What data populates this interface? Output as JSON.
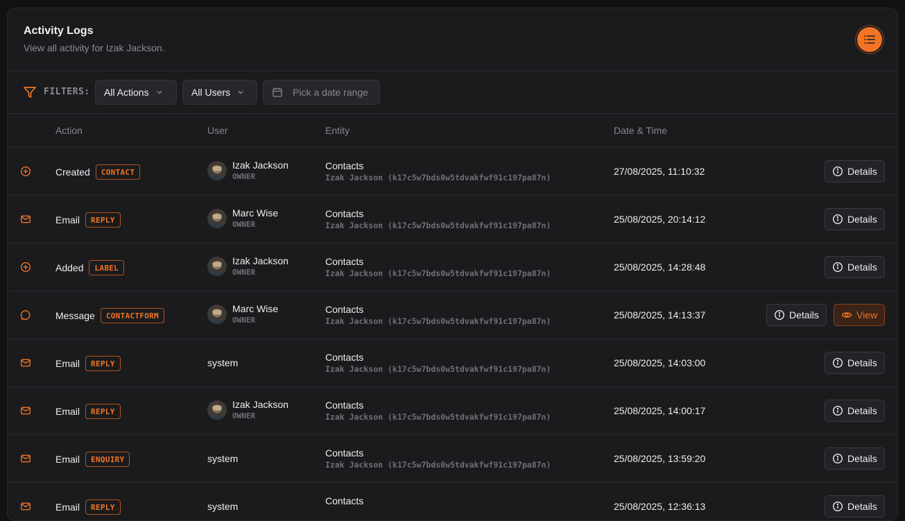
{
  "header": {
    "title": "Activity Logs",
    "subtitle": "View all activity for Izak Jackson."
  },
  "filters": {
    "label": "FILTERS:",
    "actions_value": "All Actions",
    "users_value": "All Users",
    "date_placeholder": "Pick a date range"
  },
  "table": {
    "columns": [
      "Action",
      "User",
      "Entity",
      "Date & Time"
    ],
    "details_label": "Details",
    "view_label": "View",
    "rows": [
      {
        "icon": "plus-circle-icon",
        "action": "Created",
        "badge": "CONTACT",
        "user": "Izak Jackson",
        "role": "OWNER",
        "entity": "Contacts",
        "entity_ref": "Izak Jackson (k17c5w7bds0w5tdvakfwf91c197pa87n)",
        "datetime": "27/08/2025, 11:10:32",
        "has_view": false
      },
      {
        "icon": "mail-icon",
        "action": "Email",
        "badge": "REPLY",
        "user": "Marc Wise",
        "role": "OWNER",
        "entity": "Contacts",
        "entity_ref": "Izak Jackson (k17c5w7bds0w5tdvakfwf91c197pa87n)",
        "datetime": "25/08/2025, 20:14:12",
        "has_view": false
      },
      {
        "icon": "plus-circle-icon",
        "action": "Added",
        "badge": "LABEL",
        "user": "Izak Jackson",
        "role": "OWNER",
        "entity": "Contacts",
        "entity_ref": "Izak Jackson (k17c5w7bds0w5tdvakfwf91c197pa87n)",
        "datetime": "25/08/2025, 14:28:48",
        "has_view": false
      },
      {
        "icon": "message-circle-icon",
        "action": "Message",
        "badge": "CONTACTFORM",
        "user": "Marc Wise",
        "role": "OWNER",
        "entity": "Contacts",
        "entity_ref": "Izak Jackson (k17c5w7bds0w5tdvakfwf91c197pa87n)",
        "datetime": "25/08/2025, 14:13:37",
        "has_view": true
      },
      {
        "icon": "mail-icon",
        "action": "Email",
        "badge": "REPLY",
        "user": "system",
        "role": "",
        "entity": "Contacts",
        "entity_ref": "Izak Jackson (k17c5w7bds0w5tdvakfwf91c197pa87n)",
        "datetime": "25/08/2025, 14:03:00",
        "has_view": false
      },
      {
        "icon": "mail-icon",
        "action": "Email",
        "badge": "REPLY",
        "user": "Izak Jackson",
        "role": "OWNER",
        "entity": "Contacts",
        "entity_ref": "Izak Jackson (k17c5w7bds0w5tdvakfwf91c197pa87n)",
        "datetime": "25/08/2025, 14:00:17",
        "has_view": false
      },
      {
        "icon": "mail-icon",
        "action": "Email",
        "badge": "ENQUIRY",
        "user": "system",
        "role": "",
        "entity": "Contacts",
        "entity_ref": "Izak Jackson (k17c5w7bds0w5tdvakfwf91c197pa87n)",
        "datetime": "25/08/2025, 13:59:20",
        "has_view": false
      },
      {
        "icon": "mail-icon",
        "action": "Email",
        "badge": "REPLY",
        "user": "system",
        "role": "",
        "entity": "Contacts",
        "entity_ref": "",
        "datetime": "25/08/2025, 12:36:13",
        "has_view": false
      }
    ]
  },
  "colors": {
    "accent": "#f07424",
    "background": "#1b1b1e",
    "muted_text": "#8b8b93"
  }
}
